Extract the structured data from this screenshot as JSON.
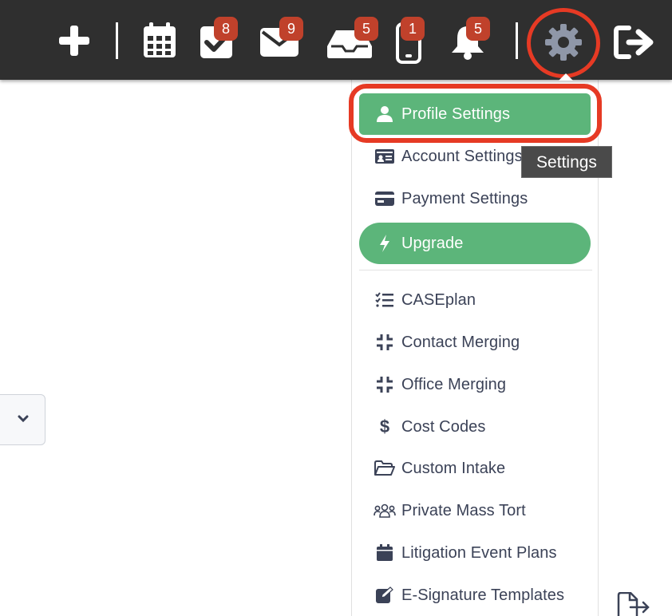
{
  "topbar": {
    "badges": {
      "tasks": "8",
      "mail": "9",
      "inbox": "5",
      "mobile": "1",
      "notifications": "5"
    },
    "colors": {
      "background": "#2f2f2f",
      "badge": "#c0412b",
      "icon": "#ffffff",
      "gear": "#8f97a8"
    }
  },
  "tooltip": {
    "text": "Settings"
  },
  "menu": {
    "items": [
      {
        "label": "Profile Settings",
        "icon": "user-icon"
      },
      {
        "label": "Account Settings",
        "icon": "id-card-icon"
      },
      {
        "label": "Payment Settings",
        "icon": "credit-card-icon"
      },
      {
        "label": "Upgrade",
        "icon": "bolt-icon"
      },
      {
        "label": "CASEplan",
        "icon": "checklist-icon"
      },
      {
        "label": "Contact Merging",
        "icon": "compress-icon"
      },
      {
        "label": "Office Merging",
        "icon": "compress-icon"
      },
      {
        "label": "Cost Codes",
        "icon": "dollar-icon"
      },
      {
        "label": "Custom Intake",
        "icon": "folder-open-icon"
      },
      {
        "label": "Private Mass Tort",
        "icon": "users-icon"
      },
      {
        "label": "Litigation Event Plans",
        "icon": "calendar-icon"
      },
      {
        "label": "E-Signature Templates",
        "icon": "edit-icon"
      }
    ],
    "colors": {
      "text": "#3b4257",
      "active": "#5cb57a",
      "highlight": "#e63a24"
    }
  }
}
